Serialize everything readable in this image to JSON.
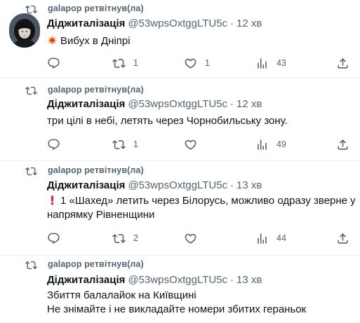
{
  "tweets": [
    {
      "retweeter": "galapop ретвітнув(ла)",
      "name": "Діджиталізація",
      "handle": "@53wpsOxtggLTU5c",
      "separator": "·",
      "time": "12 хв",
      "emoji": "collision-emoji",
      "lines": [
        "Вибух в Дніпрі"
      ],
      "replies": "",
      "retweets": "1",
      "likes": "1",
      "views": "43"
    },
    {
      "retweeter": "galapop ретвітнув(ла)",
      "name": "Діджиталізація",
      "handle": "@53wpsOxtggLTU5c",
      "separator": "·",
      "time": "12 хв",
      "emoji": "",
      "lines": [
        "три цілі в небі, летять через Чорнобильську зону."
      ],
      "replies": "",
      "retweets": "1",
      "likes": "",
      "views": "49"
    },
    {
      "retweeter": "galapop ретвітнув(ла)",
      "name": "Діджиталізація",
      "handle": "@53wpsOxtggLTU5c",
      "separator": "·",
      "time": "13 хв",
      "emoji": "exclamation-emoji",
      "lines": [
        "1 «Шахед» летить через Білорусь, можливо одразу зверне у",
        "напрямку Рівненщини"
      ],
      "replies": "",
      "retweets": "2",
      "likes": "",
      "views": "44"
    },
    {
      "retweeter": "galapop ретвітнув(ла)",
      "name": "Діджиталізація",
      "handle": "@53wpsOxtggLTU5c",
      "separator": "·",
      "time": "13 хв",
      "emoji": "",
      "lines": [
        "Збиття балалайок на Київщині",
        "Не знімайте і не викладайте номери збитих гераньок"
      ],
      "replies": "",
      "retweets": "",
      "likes": "",
      "views": ""
    }
  ],
  "icons": {
    "retweet": "retweet-icon",
    "reply": "reply-icon",
    "like": "heart-icon",
    "views": "views-icon",
    "share": "share-icon"
  },
  "colors": {
    "text": "#0f1419",
    "secondary": "#536471",
    "divider": "#eff3f4",
    "background": "#ffffff"
  }
}
